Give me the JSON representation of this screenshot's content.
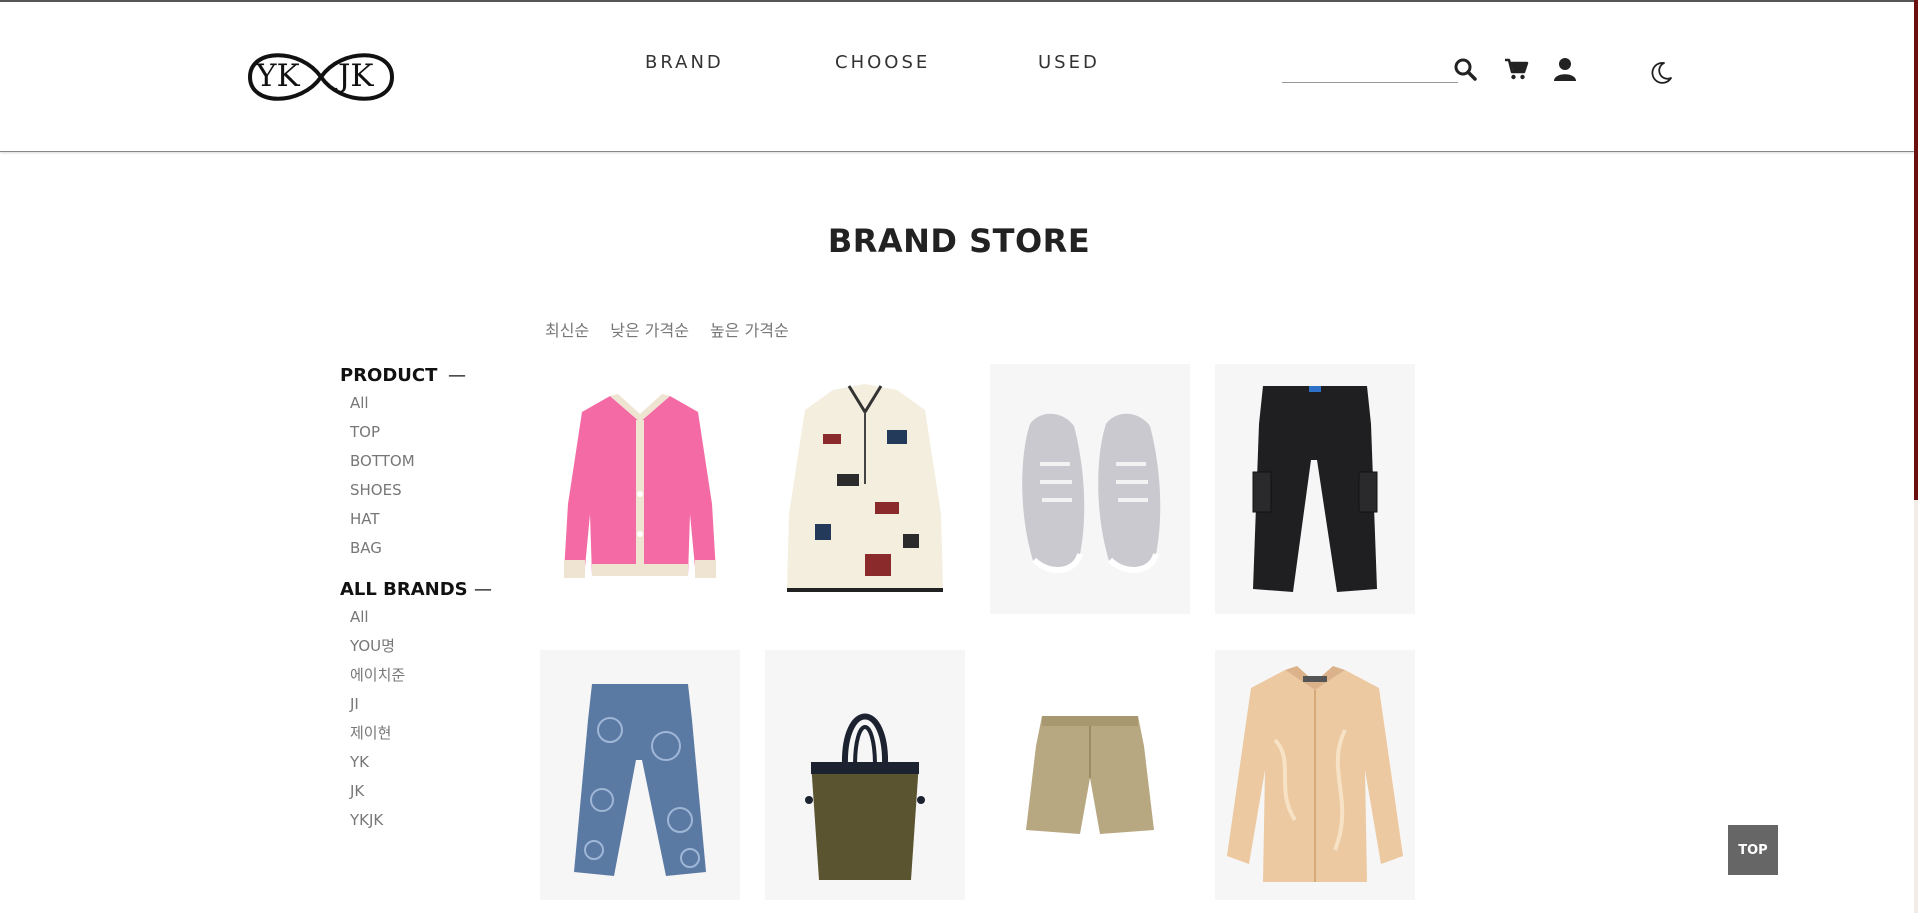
{
  "logo": {
    "left": "YK",
    "right": "JK"
  },
  "nav": {
    "items": [
      "BRAND",
      "CHOOSE",
      "USED"
    ]
  },
  "search": {
    "placeholder": ""
  },
  "header_icons": [
    "search-icon",
    "cart-icon",
    "user-icon",
    "moon-icon"
  ],
  "page": {
    "title": "BRAND STORE"
  },
  "sort": {
    "options": [
      "최신순",
      "낮은 가격순",
      "높은 가격순"
    ]
  },
  "sidebar": {
    "product": {
      "title": "PRODUCT",
      "toggle": "—",
      "items": [
        "All",
        "TOP",
        "BOTTOM",
        "SHOES",
        "HAT",
        "BAG"
      ]
    },
    "brands": {
      "title": "ALL BRANDS",
      "toggle": "—",
      "items": [
        "All",
        "YOU명",
        "에이치준",
        "JI",
        "제이현",
        "YK",
        "JK",
        "YKJK"
      ]
    }
  },
  "products": [
    {
      "item": "pink-cardigan-image"
    },
    {
      "item": "fleece-jacket-image"
    },
    {
      "item": "sneakers-image"
    },
    {
      "item": "black-cargo-pants-image"
    },
    {
      "item": "printed-jeans-image"
    },
    {
      "item": "tote-bag-image"
    },
    {
      "item": "khaki-shorts-image"
    },
    {
      "item": "satin-shirt-image"
    }
  ],
  "top_button": {
    "label": "TOP"
  },
  "colors": {
    "accent_scrollbar": "#6b1010",
    "text": "#222222",
    "muted": "#777777",
    "card_bg": "#f6f6f6",
    "top_btn": "#666666"
  }
}
